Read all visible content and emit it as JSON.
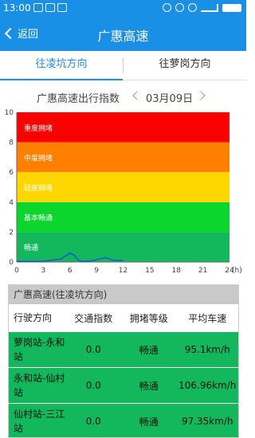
{
  "status_bar": {
    "time": "13:00",
    "icons": [
      "sim-icon",
      "voicemail-icon",
      "notification-icon",
      "nfc-icon",
      "alarm-icon",
      "wifi-icon",
      "signal-icon",
      "battery-icon"
    ]
  },
  "header": {
    "back_label": "返回",
    "title": "广惠高速"
  },
  "tabs": [
    {
      "label": "往凌坑方向",
      "active": true
    },
    {
      "label": "往萝岗方向",
      "active": false
    }
  ],
  "chart_header": {
    "title": "广惠高速出行指数",
    "date": "03月09日"
  },
  "chart_data": {
    "type": "line",
    "title": "广惠高速出行指数",
    "xlabel": "(h)",
    "ylabel": "",
    "xlim": [
      0,
      24
    ],
    "ylim": [
      0,
      10
    ],
    "xticks": [
      0,
      3,
      6,
      9,
      12,
      15,
      18,
      21,
      24
    ],
    "yticks": [
      0,
      2,
      4,
      6,
      8,
      10
    ],
    "bands": [
      {
        "label": "畅通",
        "from": 0,
        "to": 2,
        "color": "#12b85b"
      },
      {
        "label": "基本畅通",
        "from": 2,
        "to": 4,
        "color": "#0bd62e"
      },
      {
        "label": "轻度拥堵",
        "from": 4,
        "to": 6,
        "color": "#ffd700"
      },
      {
        "label": "中度拥堵",
        "from": 6,
        "to": 8,
        "color": "#ff7f00"
      },
      {
        "label": "重度拥堵",
        "from": 8,
        "to": 10,
        "color": "#fb0000"
      }
    ],
    "series": [
      {
        "color": "#1a55d8",
        "x": [
          0,
          3,
          5,
          6,
          6.5,
          7,
          7.5,
          8,
          9,
          10,
          11,
          12
        ],
        "y": [
          0.05,
          0.05,
          0.2,
          0.6,
          0.45,
          0.1,
          0.05,
          0.05,
          0.15,
          0.3,
          0.1,
          0.1
        ]
      }
    ]
  },
  "table": {
    "caption": "广惠高速(往凌坑方向)",
    "columns": [
      "行驶方向",
      "交通指数",
      "拥堵等级",
      "平均车速"
    ],
    "rows": [
      {
        "section": "萝岗站-永和站",
        "index": "0.0",
        "level": "畅通",
        "speed": "95.1km/h"
      },
      {
        "section": "永和站-仙村站",
        "index": "0.0",
        "level": "畅通",
        "speed": "106.96km/h"
      },
      {
        "section": "仙村站-三江站",
        "index": "0.0",
        "level": "畅通",
        "speed": "97.35km/h"
      }
    ]
  }
}
